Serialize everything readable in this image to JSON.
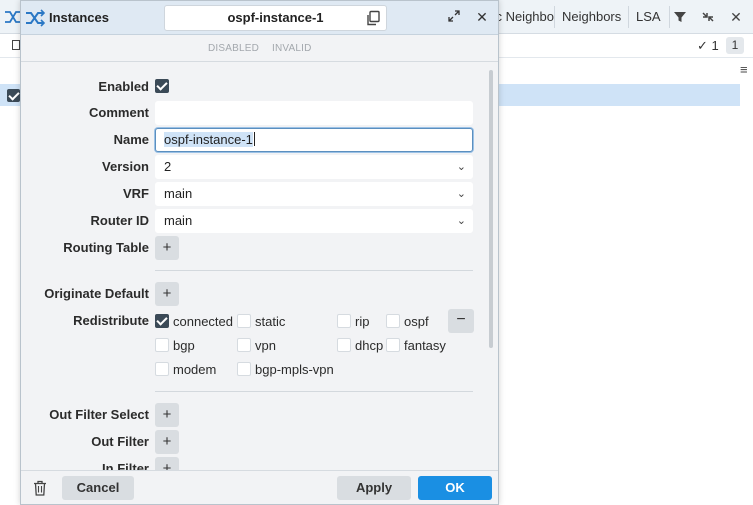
{
  "background": {
    "tabs": [
      "c Neighbo",
      "Neighbors",
      "LSA"
    ],
    "count_check": "✓ 1",
    "count_badge": "1"
  },
  "dialog": {
    "title": "Instances",
    "name_box": "ospf-instance-1",
    "status": {
      "disabled": "DISABLED",
      "invalid": "INVALID"
    },
    "fields": {
      "enabled_label": "Enabled",
      "enabled_checked": true,
      "comment_label": "Comment",
      "comment_value": "",
      "name_label": "Name",
      "name_value": "ospf-instance-1",
      "version_label": "Version",
      "version_value": "2",
      "vrf_label": "VRF",
      "vrf_value": "main",
      "router_id_label": "Router ID",
      "router_id_value": "main",
      "routing_table_label": "Routing Table",
      "originate_default_label": "Originate Default",
      "redistribute_label": "Redistribute",
      "out_filter_select_label": "Out Filter Select",
      "out_filter_label": "Out Filter",
      "in_filter_label": "In Filter"
    },
    "redistribute_options": [
      {
        "label": "connected",
        "checked": true
      },
      {
        "label": "static",
        "checked": false
      },
      {
        "label": "rip",
        "checked": false
      },
      {
        "label": "ospf",
        "checked": false
      },
      {
        "label": "bgp",
        "checked": false
      },
      {
        "label": "vpn",
        "checked": false
      },
      {
        "label": "dhcp",
        "checked": false
      },
      {
        "label": "fantasy",
        "checked": false
      },
      {
        "label": "modem",
        "checked": false
      },
      {
        "label": "bgp-mpls-vpn",
        "checked": false
      }
    ],
    "plus": "+",
    "minus": "−",
    "footer": {
      "cancel": "Cancel",
      "apply": "Apply",
      "ok": "OK"
    }
  },
  "colors": {
    "accent": "#1a8fe3",
    "header_bg": "#dfe9f3",
    "selected_row": "#cfe3f7"
  }
}
